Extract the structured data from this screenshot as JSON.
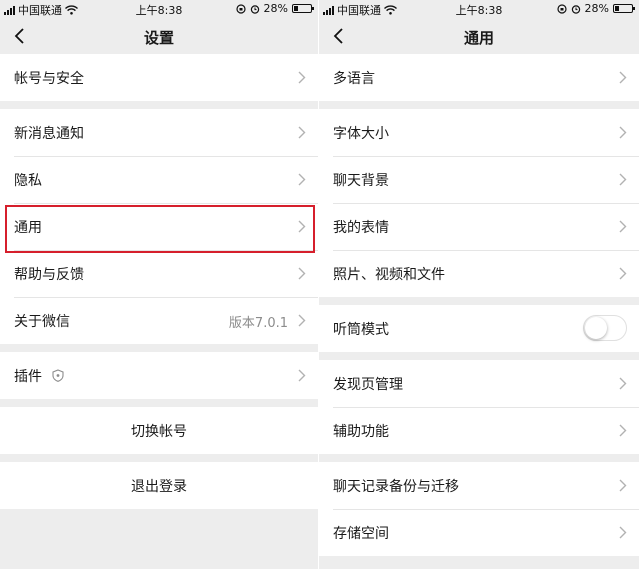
{
  "status_bar": {
    "carrier": "中国联通",
    "time": "上午8:38",
    "battery": "28%",
    "battery_level": 0.28
  },
  "left": {
    "title": "设置",
    "groups": [
      [
        {
          "label": "帐号与安全"
        }
      ],
      [
        {
          "label": "新消息通知"
        },
        {
          "label": "隐私"
        },
        {
          "label": "通用"
        },
        {
          "label": "帮助与反馈"
        },
        {
          "label": "关于微信",
          "value": "版本7.0.1"
        }
      ],
      [
        {
          "label": "插件"
        }
      ],
      [
        {
          "label": "切换帐号"
        }
      ],
      [
        {
          "label": "退出登录"
        }
      ]
    ]
  },
  "right": {
    "title": "通用",
    "groups": [
      [
        {
          "label": "多语言"
        }
      ],
      [
        {
          "label": "字体大小"
        },
        {
          "label": "聊天背景"
        },
        {
          "label": "我的表情"
        },
        {
          "label": "照片、视频和文件"
        }
      ],
      [
        {
          "label": "听筒模式",
          "toggle": false
        }
      ],
      [
        {
          "label": "发现页管理"
        },
        {
          "label": "辅助功能"
        }
      ],
      [
        {
          "label": "聊天记录备份与迁移"
        },
        {
          "label": "存储空间"
        }
      ]
    ]
  },
  "colors": {
    "highlight": "#d61f2c",
    "background": "#ededed",
    "chevron": "#b2b2b2"
  }
}
